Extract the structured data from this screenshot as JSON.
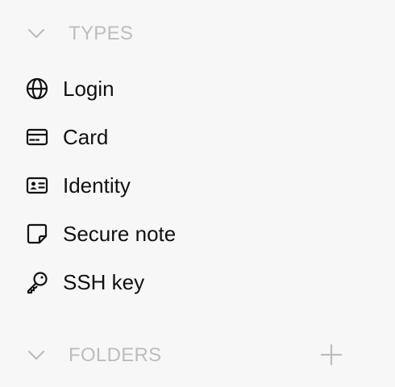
{
  "sidebar": {
    "types_section": {
      "title": "TYPES",
      "icon": "chevron-down-icon",
      "items": [
        {
          "label": "Login",
          "icon": "globe-icon"
        },
        {
          "label": "Card",
          "icon": "credit-card-icon"
        },
        {
          "label": "Identity",
          "icon": "id-card-icon"
        },
        {
          "label": "Secure note",
          "icon": "sticky-note-icon"
        },
        {
          "label": "SSH key",
          "icon": "key-icon"
        }
      ]
    },
    "folders_section": {
      "title": "FOLDERS",
      "icon": "chevron-down-icon",
      "add_icon": "plus-icon"
    }
  },
  "colors": {
    "background": "#f7f7f7",
    "text": "#111111",
    "muted": "#bdbdbd"
  }
}
